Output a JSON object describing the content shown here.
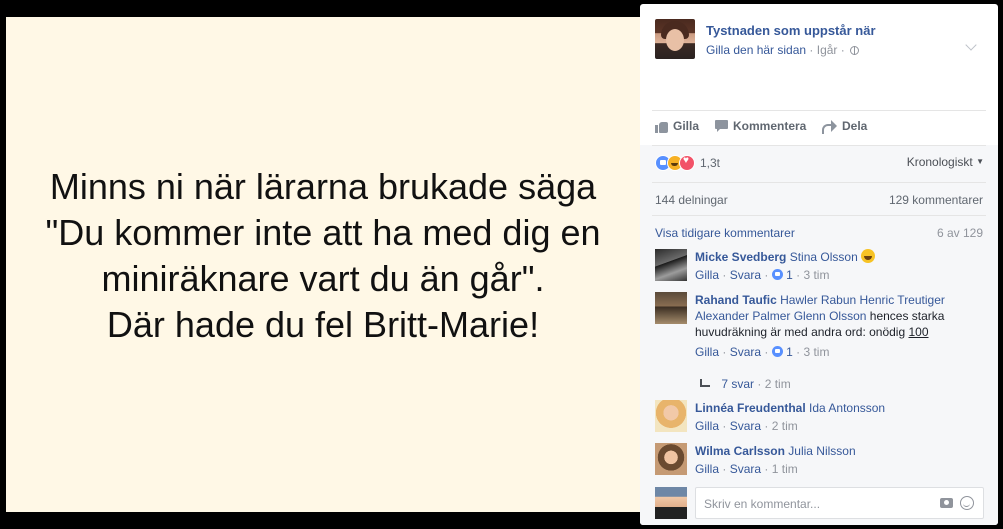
{
  "photo": {
    "lines": [
      "Minns ni när lärarna brukade säga",
      "\"Du kommer inte att ha med dig en",
      "miniräknare vart du än går\".",
      "Där hade du fel Britt-Marie!"
    ]
  },
  "post": {
    "page_name": "Tystnaden som uppstår när",
    "like_page": "Gilla den här sidan",
    "time": "Igår"
  },
  "actions": {
    "like": "Gilla",
    "comment": "Kommentera",
    "share": "Dela"
  },
  "reactions": {
    "count": "1,3t",
    "sort": "Kronologiskt"
  },
  "stats": {
    "shares": "144 delningar",
    "comments": "129 kommentarer"
  },
  "previous": {
    "label": "Visa tidigare kommentarer",
    "position": "6 av 129"
  },
  "comments": [
    {
      "author": "Micke Svedberg",
      "tags": "Stina Olsson",
      "text": "",
      "like": "Gilla",
      "reply": "Svara",
      "likes": "1",
      "time": "3 tim"
    },
    {
      "author": "Rahand Taufic",
      "tags": "Hawler Rabun Henric Treutiger Alexander Palmer Glenn Olsson",
      "text": "hences starka huvudräkning är med andra ord: onödig",
      "link": "100",
      "like": "Gilla",
      "reply": "Svara",
      "likes": "1",
      "time": "3 tim",
      "replies": "7 svar",
      "replies_time": "2 tim"
    },
    {
      "author": "Linnéa Freudenthal",
      "tags": "Ida Antonsson",
      "like": "Gilla",
      "reply": "Svara",
      "time": "2 tim"
    },
    {
      "author": "Wilma Carlsson",
      "tags": "Julia Nilsson",
      "like": "Gilla",
      "reply": "Svara",
      "time": "1 tim"
    }
  ],
  "compose": {
    "placeholder": "Skriv en kommentar..."
  },
  "colors": {
    "link": "#365899",
    "photo_bg": "#fff8e6",
    "panel_gray": "#f6f7f9"
  }
}
